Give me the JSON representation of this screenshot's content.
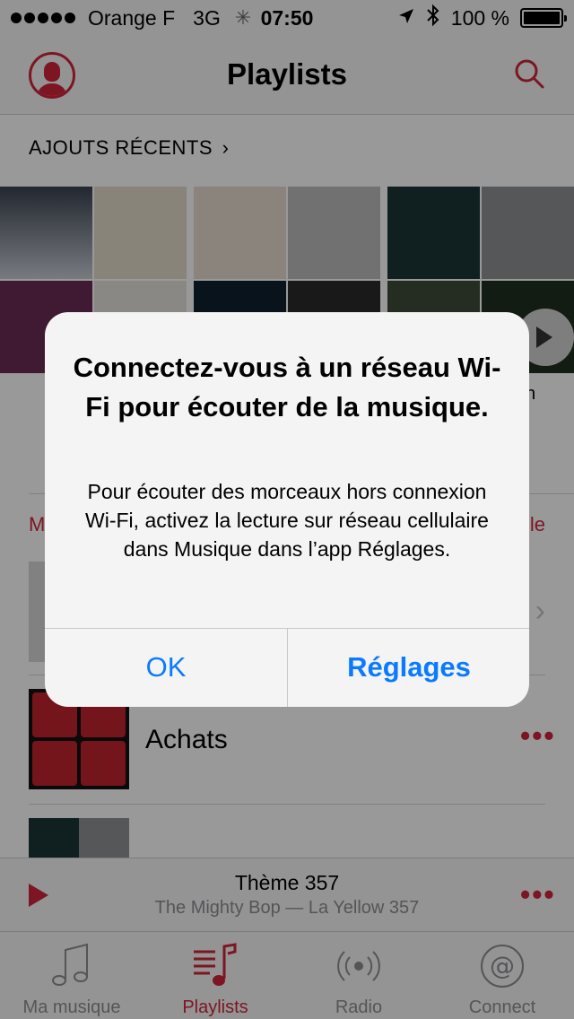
{
  "status_bar": {
    "carrier": "Orange F",
    "network": "3G",
    "time": "07:50",
    "battery": "100 %",
    "battery_level": 1.0
  },
  "nav": {
    "title": "Playlists"
  },
  "recent": {
    "header": "AJOUTS RÉCENTS",
    "caption_partial": "n"
  },
  "section": {
    "left_partial": "M",
    "right_partial": "le"
  },
  "rows": [
    {
      "label": "Achats"
    }
  ],
  "mini_player": {
    "title": "Thème 357",
    "subtitle": "The Mighty Bop — La Yellow 357"
  },
  "tabs": [
    {
      "label": "Ma musique",
      "icon": "note-icon",
      "active": false
    },
    {
      "label": "Playlists",
      "icon": "playlist-icon",
      "active": true
    },
    {
      "label": "Radio",
      "icon": "radio-icon",
      "active": false
    },
    {
      "label": "Connect",
      "icon": "at-icon",
      "active": false
    }
  ],
  "alert": {
    "title": "Connectez-vous à un réseau Wi-Fi pour écouter de la musique.",
    "message": "Pour écouter des morceaux hors connexion Wi-Fi, activez la lecture sur réseau cellulaire dans Musique dans l’app Réglages.",
    "ok_label": "OK",
    "settings_label": "Réglages"
  },
  "colors": {
    "accent": "#d1263a",
    "link": "#0a7aff"
  }
}
